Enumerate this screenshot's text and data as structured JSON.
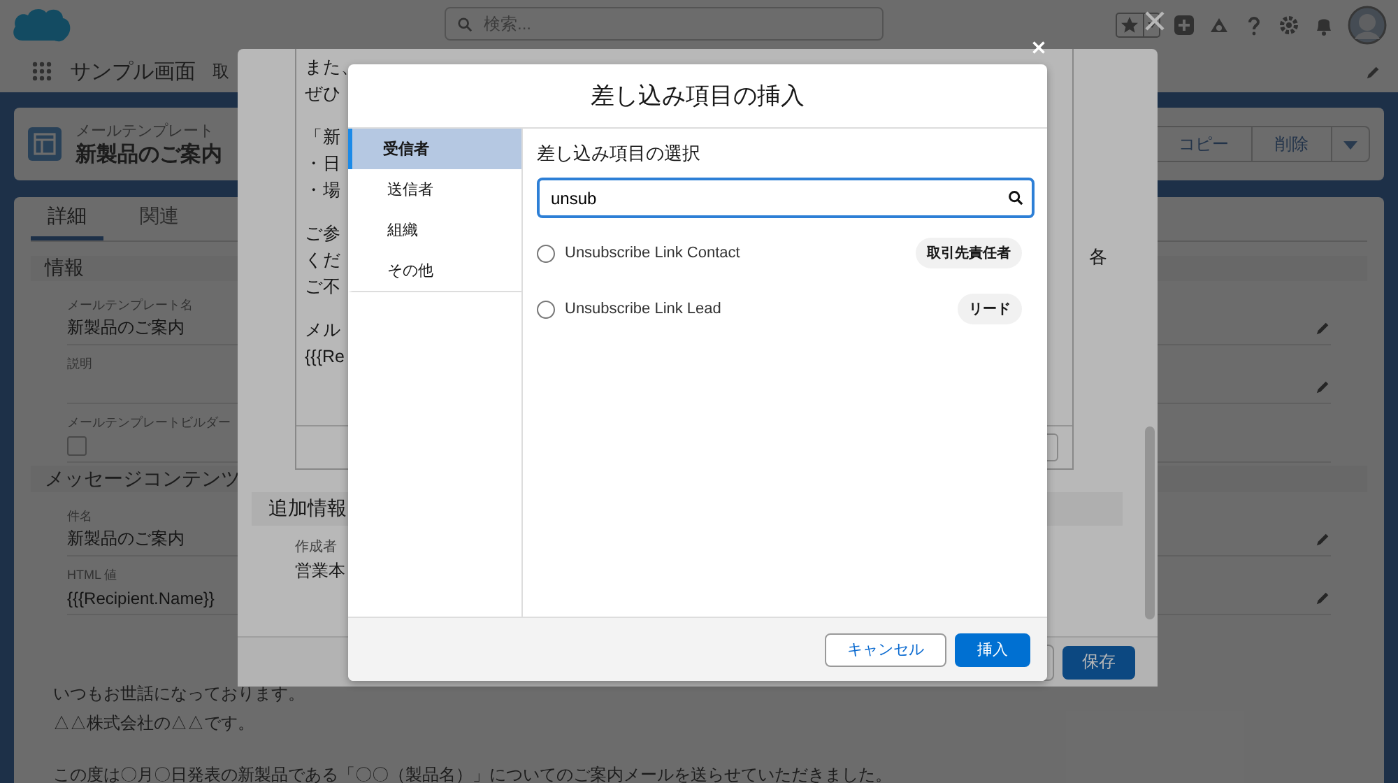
{
  "header": {
    "search": {
      "placeholder": "検索..."
    }
  },
  "nav": {
    "app_name": "サンプル画面",
    "items": [
      "取"
    ]
  },
  "record": {
    "type": "メールテンプレート",
    "title": "新製品のご案内",
    "actions": [
      "コピー",
      "削除"
    ]
  },
  "tabs": [
    {
      "label": "詳細",
      "selected": true
    },
    {
      "label": "関連",
      "selected": false
    }
  ],
  "sections": [
    {
      "title": "情報",
      "fields": [
        {
          "kind": "text",
          "label": "メールテンプレート名",
          "value": "新製品のご案内",
          "editable": true
        },
        {
          "kind": "text",
          "label": "説明",
          "editable": true
        },
        {
          "kind": "checkbox",
          "label": "メールテンプレートビルダー",
          "checked": false,
          "editable": false
        }
      ]
    },
    {
      "title": "メッセージコンテンツ",
      "fields": [
        {
          "kind": "text",
          "label": "件名",
          "value": "新製品のご案内",
          "editable": true
        },
        {
          "kind": "text",
          "label": "HTML 値",
          "value": "{{{Recipient.Name}}",
          "editable": true
        }
      ]
    }
  ],
  "body_paragraphs": [
    [
      "いつもお世話になっております。",
      "△△株式会社の△△です。"
    ],
    [
      "この度は〇月〇日発表の新製品である「〇〇（製品名）」についてのご案内メールを送らせていただきました。"
    ]
  ],
  "edit_modal": {
    "paragraphs": [
      [
        "また、",
        "ぜひ"
      ],
      [
        "「新",
        "・日",
        "・場"
      ],
      [
        "ご参",
        "くだ",
        "ご不"
      ],
      [
        "メル",
        "{{{Re"
      ]
    ],
    "cut_right": "各",
    "section": "追加情報",
    "fields": [
      {
        "label": "作成者",
        "value": "営業本"
      }
    ],
    "save": "保存"
  },
  "insert_modal": {
    "title": "差し込み項目の挿入",
    "categories": [
      {
        "label": "受信者",
        "selected": true
      },
      {
        "label": "送信者",
        "selected": false
      },
      {
        "label": "組織",
        "selected": false
      },
      {
        "label": "その他",
        "selected": false
      }
    ],
    "heading": "差し込み項目の選択",
    "search": {
      "value": "unsub"
    },
    "options": [
      {
        "label": "Unsubscribe Link Contact",
        "badge": "取引先責任者",
        "selected": false
      },
      {
        "label": "Unsubscribe Link Lead",
        "badge": "リード",
        "selected": false
      }
    ],
    "buttons": [
      {
        "kind": "neutral",
        "label": "キャンセル"
      },
      {
        "kind": "brand",
        "label": "挿入"
      }
    ]
  }
}
